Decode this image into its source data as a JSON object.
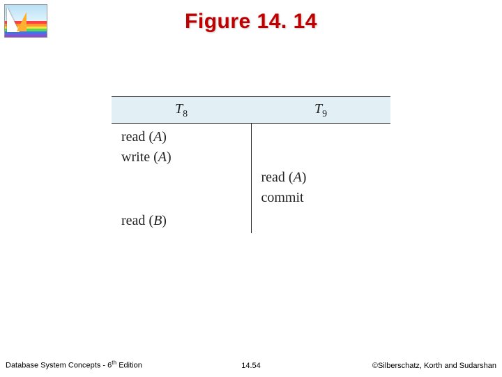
{
  "title": "Figure 14. 14",
  "table": {
    "headers": {
      "t8": "T",
      "t8_sub": "8",
      "t9": "T",
      "t9_sub": "9"
    },
    "rows": [
      {
        "left": "read (A)",
        "right": ""
      },
      {
        "left": "write (A)",
        "right": ""
      },
      {
        "left": "",
        "right": "read (A)"
      },
      {
        "left": "",
        "right": "commit"
      },
      {
        "left": "read (B)",
        "right": ""
      }
    ]
  },
  "footer": {
    "left_prefix": "Database System Concepts - 6",
    "left_suffix": " Edition",
    "left_sup": "th",
    "mid": "14.54",
    "right": "©Silberschatz, Korth and Sudarshan"
  }
}
